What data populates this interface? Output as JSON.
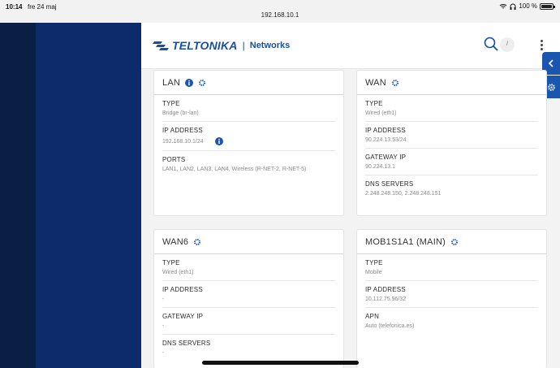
{
  "status_bar": {
    "time": "10:14",
    "date": "fre 24 maj",
    "url": "192.168.10.1",
    "battery": "100 %"
  },
  "header": {
    "brand": "TELTONIKA",
    "separator": "|",
    "product": "Networks",
    "search_shortcut": "/"
  },
  "cards": [
    {
      "title": "LAN",
      "fields": [
        {
          "label": "TYPE",
          "value": "Bridge (br-lan)"
        },
        {
          "label": "IP ADDRESS",
          "value": "192.168.10.1/24"
        },
        {
          "label": "PORTS",
          "value": "LAN1, LAN2, LAN3, LAN4, Wireless (R-NET-2, R-NET-5)"
        }
      ]
    },
    {
      "title": "WAN",
      "fields": [
        {
          "label": "TYPE",
          "value": "Wired (eth1)"
        },
        {
          "label": "IP ADDRESS",
          "value": "90.224.13.53/24"
        },
        {
          "label": "GATEWAY IP",
          "value": "90.224.13.1"
        },
        {
          "label": "DNS SERVERS",
          "value": "2.248.248.150, 2.248.248.151"
        }
      ]
    },
    {
      "title": "WAN6",
      "fields": [
        {
          "label": "TYPE",
          "value": "Wired (eth1)"
        },
        {
          "label": "IP ADDRESS",
          "value": "-"
        },
        {
          "label": "GATEWAY IP",
          "value": "-"
        },
        {
          "label": "DNS SERVERS",
          "value": "-"
        }
      ]
    },
    {
      "title": "MOB1S1A1 (MAIN)",
      "fields": [
        {
          "label": "TYPE",
          "value": "Mobile"
        },
        {
          "label": "IP ADDRESS",
          "value": "10.112.75.96/32"
        },
        {
          "label": "APN",
          "value": "Auto (telefonica.es)"
        }
      ]
    }
  ],
  "colors": {
    "brand": "#1a4fa0",
    "sidebar_dark": "#0a1f44",
    "sidebar_blue": "#0d2b6b",
    "tab_blue": "#1a56b0"
  },
  "icons": [
    "info-icon",
    "gear-icon",
    "search-icon",
    "kebab-menu-icon",
    "chevron-left-icon",
    "wifi-icon",
    "headphones-icon",
    "battery-icon"
  ]
}
